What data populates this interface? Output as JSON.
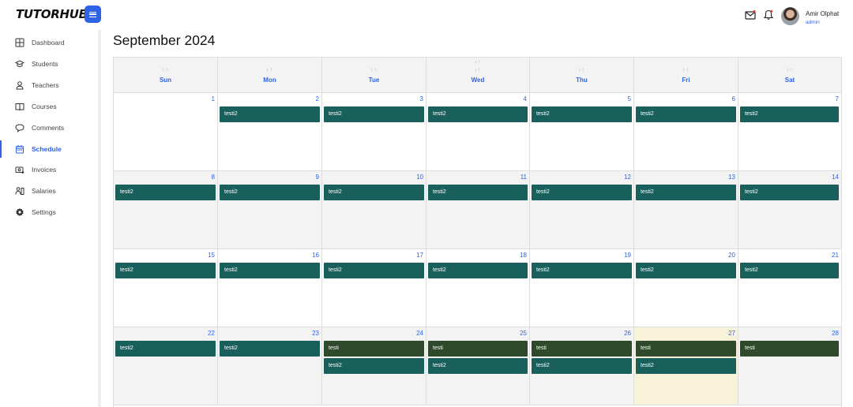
{
  "brand": {
    "logo_text": "TUTORHUB"
  },
  "user": {
    "name": "Amir Olphat",
    "role": "admin"
  },
  "sidebar": {
    "items": [
      {
        "label": "Dashboard",
        "icon": "grid-icon"
      },
      {
        "label": "Students",
        "icon": "graduation-cap-icon"
      },
      {
        "label": "Teachers",
        "icon": "person-icon"
      },
      {
        "label": "Courses",
        "icon": "book-icon"
      },
      {
        "label": "Comments",
        "icon": "speech-bubble-icon"
      },
      {
        "label": "Schedule",
        "icon": "calendar-icon",
        "active": true
      },
      {
        "label": "Invoices",
        "icon": "invoice-icon"
      },
      {
        "label": "Salaries",
        "icon": "salary-icon"
      },
      {
        "label": "Settings",
        "icon": "gear-icon"
      }
    ]
  },
  "calendar": {
    "title": "September 2024",
    "days": [
      "Sun",
      "Mon",
      "Tue",
      "Wed",
      "Thu",
      "Fri",
      "Sat"
    ],
    "weeks": [
      [
        {
          "day": "1",
          "events": []
        },
        {
          "day": "2",
          "events": [
            "testi2"
          ]
        },
        {
          "day": "3",
          "events": [
            "testi2"
          ]
        },
        {
          "day": "4",
          "events": [
            "testi2"
          ]
        },
        {
          "day": "5",
          "events": [
            "testi2"
          ]
        },
        {
          "day": "6",
          "events": [
            "testi2"
          ]
        },
        {
          "day": "7",
          "events": [
            "testi2"
          ]
        }
      ],
      [
        {
          "day": "8",
          "events": [
            "testi2"
          ]
        },
        {
          "day": "9",
          "events": [
            "testi2"
          ]
        },
        {
          "day": "10",
          "events": [
            "testi2"
          ]
        },
        {
          "day": "11",
          "events": [
            "testi2"
          ]
        },
        {
          "day": "12",
          "events": [
            "testi2"
          ]
        },
        {
          "day": "13",
          "events": [
            "testi2"
          ]
        },
        {
          "day": "14",
          "events": [
            "testi2"
          ]
        }
      ],
      [
        {
          "day": "15",
          "events": [
            "testi2"
          ]
        },
        {
          "day": "16",
          "events": [
            "testi2"
          ]
        },
        {
          "day": "17",
          "events": [
            "testi2"
          ]
        },
        {
          "day": "18",
          "events": [
            "testi2"
          ]
        },
        {
          "day": "19",
          "events": [
            "testi2"
          ]
        },
        {
          "day": "20",
          "events": [
            "testi2"
          ]
        },
        {
          "day": "21",
          "events": [
            "testi2"
          ]
        }
      ],
      [
        {
          "day": "22",
          "events": [
            "testi2"
          ]
        },
        {
          "day": "23",
          "events": [
            "testi2"
          ]
        },
        {
          "day": "24",
          "events": [
            "testi",
            "testi2"
          ]
        },
        {
          "day": "25",
          "events": [
            "testi",
            "testi2"
          ]
        },
        {
          "day": "26",
          "events": [
            "testi",
            "testi2"
          ]
        },
        {
          "day": "27",
          "events": [
            "testi",
            "testi2"
          ],
          "today": true
        },
        {
          "day": "28",
          "events": [
            "testi"
          ]
        }
      ]
    ]
  },
  "colors": {
    "accent": "#2f63e6",
    "event_testi2": "#19605d",
    "event_testi": "#2e4a2a",
    "today_bg": "#f7f2d8"
  }
}
